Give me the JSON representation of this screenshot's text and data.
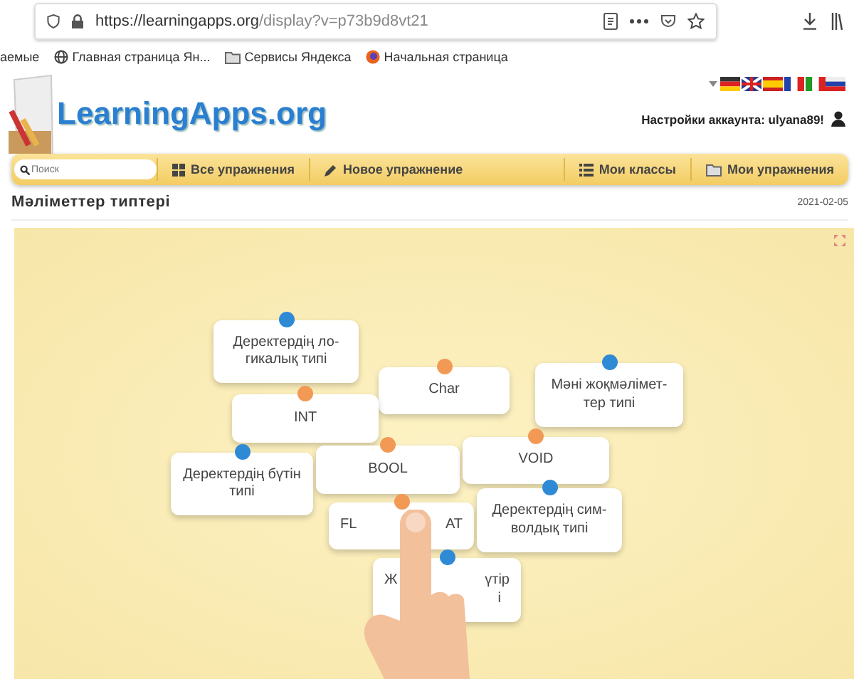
{
  "browser": {
    "url_host": "https://learningapps.org",
    "url_path": "/display?v=p73b9d8vt21",
    "bookmarks": [
      {
        "label": "аемые",
        "kind": "plain"
      },
      {
        "label": "Главная страница Ян...",
        "kind": "globe"
      },
      {
        "label": "Сервисы Яндекса",
        "kind": "folder"
      },
      {
        "label": "Начальная страница",
        "kind": "firefox"
      }
    ]
  },
  "site": {
    "logo": "LearningApps.org",
    "account": "Настройки аккаунта: ulyana89!",
    "nav": {
      "search_placeholder": "Поиск",
      "items": [
        {
          "label": "Все упражнения",
          "kind": "grid"
        },
        {
          "label": "Новое упражнение",
          "kind": "pencil"
        },
        {
          "label": "Мои классы",
          "kind": "list"
        },
        {
          "label": "Мои упражнения",
          "kind": "folder"
        }
      ]
    },
    "title": "Мәліметтер типтері",
    "date": "2021-02-05"
  },
  "cards": [
    {
      "lines": [
        [
          "Деректердің ло-"
        ],
        [
          "гикалық типі"
        ]
      ],
      "color": "#2f8ad6"
    },
    {
      "lines": [
        [
          "Char"
        ]
      ],
      "color": "#f29a55"
    },
    {
      "lines": [
        [
          "Мәні жоқмәлімет-"
        ],
        [
          "тер типі"
        ]
      ],
      "color": "#2f8ad6"
    },
    {
      "lines": [
        [
          "INT"
        ]
      ],
      "color": "#f29a55"
    },
    {
      "lines": [
        [
          "Деректердің бүтін"
        ],
        [
          "типі"
        ]
      ],
      "color": "#2f8ad6"
    },
    {
      "lines": [
        [
          "BOOL"
        ]
      ],
      "color": "#f29a55"
    },
    {
      "lines": [
        [
          "VOID"
        ]
      ],
      "color": "#f29a55"
    },
    {
      "lines": [
        [
          "FL",
          "AT"
        ]
      ],
      "color": "#f29a55"
    },
    {
      "lines": [
        [
          "Деректердің сим-"
        ],
        [
          "волдық типі"
        ]
      ],
      "color": "#2f8ad6"
    },
    {
      "lines": [
        [
          "Ж",
          "үтір"
        ],
        [
          "і"
        ]
      ],
      "color": "#2f8ad6"
    }
  ]
}
